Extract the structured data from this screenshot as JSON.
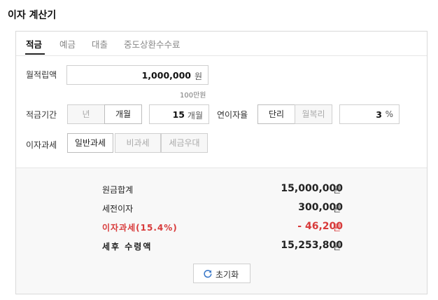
{
  "page": {
    "title": "이자 계산기"
  },
  "tabs": [
    {
      "label": "적금",
      "active": true
    },
    {
      "label": "예금",
      "active": false
    },
    {
      "label": "대출",
      "active": false
    },
    {
      "label": "중도상환수수료",
      "active": false
    }
  ],
  "form": {
    "monthly": {
      "label": "월적립액",
      "value": "1,000,000",
      "unit": "원",
      "hint": "100만원"
    },
    "period": {
      "label": "적금기간",
      "options": [
        "년",
        "개월"
      ],
      "selected": "개월",
      "value": "15",
      "unit": "개월"
    },
    "rate": {
      "label": "연이자율",
      "options": [
        "단리",
        "월복리"
      ],
      "selected": "단리",
      "value": "3",
      "unit": "%"
    },
    "tax": {
      "label": "이자과세",
      "options": [
        "일반과세",
        "비과세",
        "세금우대"
      ],
      "selected": "일반과세"
    }
  },
  "results": {
    "principal": {
      "label": "원금합계",
      "value": "15,000,000",
      "unit": "원"
    },
    "interest": {
      "label": "세전이자",
      "value": "300,000",
      "unit": "원"
    },
    "tax": {
      "label": "이자과세(15.4%)",
      "value": "- 46,200",
      "unit": "원"
    },
    "net": {
      "label": "세후 수령액",
      "value": "15,253,800",
      "unit": "원"
    }
  },
  "reset_label": "초기화",
  "colors": {
    "accent_red": "#d83a3a",
    "result_bg": "#f8f8f8"
  },
  "icons": {
    "reset": "refresh-icon"
  }
}
